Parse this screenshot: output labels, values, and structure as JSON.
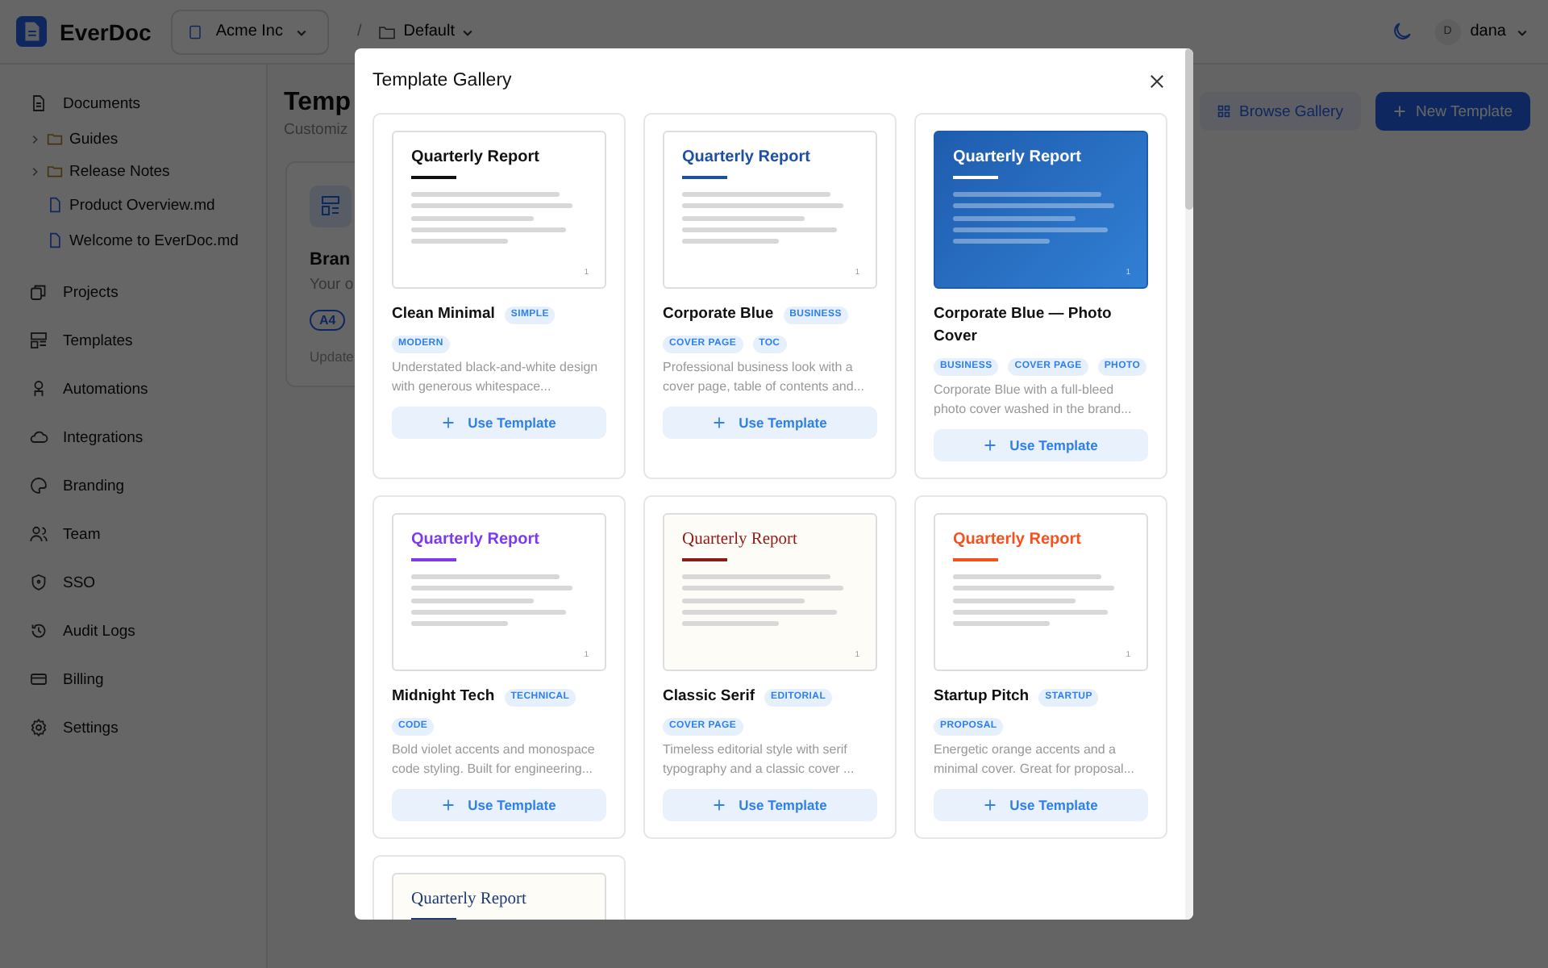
{
  "app": {
    "name": "EverDoc"
  },
  "header": {
    "org": "Acme Inc",
    "separator": "/",
    "workspace": "Default",
    "user_initial": "D",
    "user_name": "dana"
  },
  "sidebar": {
    "items": [
      {
        "label": "Documents",
        "children": [
          {
            "label": "Guides",
            "kind": "folder",
            "expanded": false
          },
          {
            "label": "Release Notes",
            "kind": "folder",
            "expanded": false
          },
          {
            "label": "Product Overview.md",
            "kind": "file"
          },
          {
            "label": "Welcome to EverDoc.md",
            "kind": "file"
          }
        ]
      },
      {
        "label": "Projects"
      },
      {
        "label": "Templates"
      },
      {
        "label": "Automations"
      },
      {
        "label": "Integrations"
      },
      {
        "label": "Branding"
      },
      {
        "label": "Team"
      },
      {
        "label": "SSO"
      },
      {
        "label": "Audit Logs"
      },
      {
        "label": "Billing"
      },
      {
        "label": "Settings"
      }
    ]
  },
  "page": {
    "title": "Temp",
    "subtitle": "Customiz",
    "buttons": [
      {
        "label": "Browse Gallery",
        "kind": "secondary"
      },
      {
        "label": "New Template",
        "kind": "primary"
      }
    ],
    "card": {
      "title": "Bran",
      "description": "Your o",
      "badge": "A4",
      "meta": "Update"
    }
  },
  "modal": {
    "title": "Template Gallery",
    "cards": [
      {
        "preview": {
          "kind": "plain",
          "heading": "Quarterly Report",
          "color": "#111111",
          "page_number": "1"
        },
        "name": "Clean Minimal",
        "category": "SIMPLE",
        "tags": [
          "MODERN"
        ],
        "description": "Understated black-and-white design with generous whitespace...",
        "button": "Use Template"
      },
      {
        "preview": {
          "kind": "plain",
          "heading": "Quarterly Report",
          "color": "#1e4fa0",
          "page_number": "1"
        },
        "name": "Corporate Blue",
        "category": "BUSINESS",
        "tags": [
          "COVER PAGE",
          "TOC"
        ],
        "description": "Professional business look with a cover page, table of contents and...",
        "button": "Use Template"
      },
      {
        "preview": {
          "kind": "photo",
          "heading": "Quarterly Report",
          "color": "#ffffff",
          "page_number": "1"
        },
        "name": "Corporate Blue — Photo Cover",
        "tags": [
          "BUSINESS",
          "COVER PAGE",
          "PHOTO"
        ],
        "description": "Corporate Blue with a full-bleed photo cover washed in the brand...",
        "button": "Use Template"
      },
      {
        "preview": {
          "kind": "plain",
          "heading": "Quarterly Report",
          "color": "#7c3aed",
          "page_number": "1"
        },
        "name": "Midnight Tech",
        "category": "TECHNICAL",
        "tags": [
          "CODE"
        ],
        "description": "Bold violet accents and monospace code styling. Built for engineering...",
        "button": "Use Template"
      },
      {
        "preview": {
          "kind": "serif",
          "heading": "Quarterly Report",
          "color": "#8b1a1a",
          "page_number": "1"
        },
        "name": "Classic Serif",
        "category": "EDITORIAL",
        "tags": [
          "COVER PAGE"
        ],
        "description": "Timeless editorial style with serif typography and a classic cover ...",
        "button": "Use Template"
      },
      {
        "preview": {
          "kind": "plain",
          "heading": "Quarterly Report",
          "color": "#f4511e",
          "page_number": "1"
        },
        "name": "Startup Pitch",
        "category": "STARTUP",
        "tags": [
          "PROPOSAL"
        ],
        "description": "Energetic orange accents and a minimal cover. Great for proposal...",
        "button": "Use Template"
      },
      {
        "preview": {
          "kind": "serif",
          "heading": "Quarterly Report",
          "color": "#1e3a6e"
        }
      }
    ]
  }
}
